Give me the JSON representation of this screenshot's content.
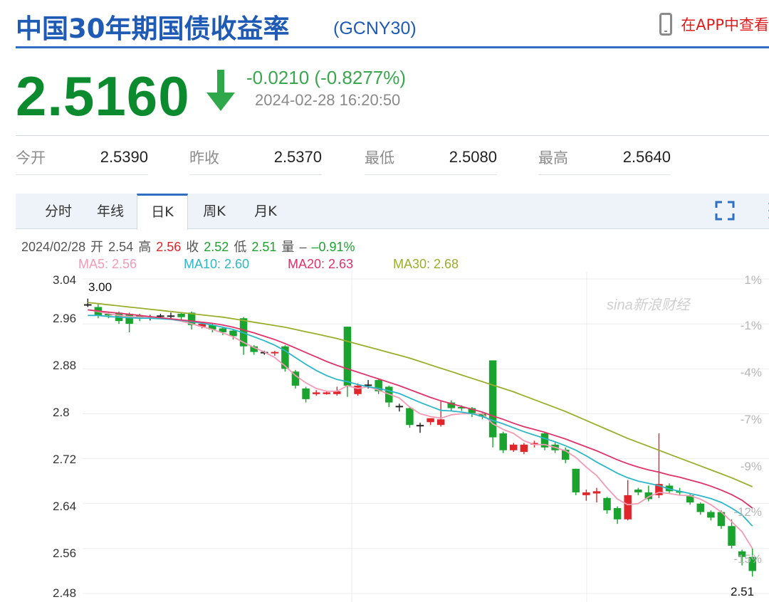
{
  "header": {
    "title": "中国30年期国债收益率",
    "code": "(GCNY30)",
    "app_link": "在APP中查看"
  },
  "quote": {
    "price": "2.5160",
    "change": "-0.0210 (-0.8277%)",
    "timestamp": "2024-02-28 16:20:50",
    "direction": "down",
    "down_color": "#0b8a2e"
  },
  "stats": [
    {
      "label": "今开",
      "value": "2.5390"
    },
    {
      "label": "昨收",
      "value": "2.5370"
    },
    {
      "label": "最低",
      "value": "2.5080"
    },
    {
      "label": "最高",
      "value": "2.5640"
    }
  ],
  "tabs": [
    {
      "label": "分时",
      "active": false
    },
    {
      "label": "年线",
      "active": false
    },
    {
      "label": "日K",
      "active": true
    },
    {
      "label": "周K",
      "active": false
    },
    {
      "label": "月K",
      "active": false
    }
  ],
  "icons": {
    "fullscreen": "fullscreen-icon",
    "more": "more-vertical-icon",
    "phone": "phone-icon",
    "arrow": "arrow-down-icon"
  },
  "info": {
    "date": "2024/02/28",
    "open_label": "开",
    "open": "2.54",
    "high_label": "高",
    "high": "2.56",
    "close_label": "收",
    "close": "2.52",
    "low_label": "低",
    "low": "2.51",
    "vol_label": "量",
    "vol": "–",
    "pct": "–0.91%"
  },
  "ma_legend": [
    {
      "text": "MA5: 2.56",
      "color": "#f29bb5"
    },
    {
      "text": "MA10: 2.60",
      "color": "#2cb7c9"
    },
    {
      "text": "MA20: 2.63",
      "color": "#e0336a"
    },
    {
      "text": "MA30: 2.68",
      "color": "#9aae2c"
    }
  ],
  "watermark": "sina新浪财经",
  "chart_data": {
    "type": "candlestick",
    "ylim": [
      2.48,
      3.04
    ],
    "y_ticks": [
      "3.04",
      "2.96",
      "2.88",
      "2.8",
      "2.72",
      "2.64",
      "2.56",
      "2.48"
    ],
    "pct_ticks": [
      "1%",
      "-1%",
      "-4%",
      "-7%",
      "-9%",
      "-12%",
      "-15%"
    ],
    "max_label": "3.00",
    "min_label": "2.51",
    "up_color": "#e0262b",
    "down_color": "#1aa32e",
    "candles": [
      [
        2.995,
        2.995,
        3.005,
        2.99
      ],
      [
        2.99,
        2.975,
        2.995,
        2.97
      ],
      [
        2.978,
        2.975,
        2.98,
        2.97
      ],
      [
        2.98,
        2.965,
        2.982,
        2.96
      ],
      [
        2.978,
        2.96,
        2.98,
        2.945
      ],
      [
        2.975,
        2.97,
        2.978,
        2.965
      ],
      [
        2.972,
        2.972,
        2.976,
        2.966
      ],
      [
        2.975,
        2.975,
        2.978,
        2.97
      ],
      [
        2.975,
        2.975,
        2.98,
        2.97
      ],
      [
        2.978,
        2.972,
        2.98,
        2.968
      ],
      [
        2.98,
        2.958,
        2.982,
        2.95
      ],
      [
        2.955,
        2.96,
        2.962,
        2.952
      ],
      [
        2.958,
        2.95,
        2.962,
        2.945
      ],
      [
        2.952,
        2.945,
        2.955,
        2.94
      ],
      [
        2.948,
        2.938,
        2.95,
        2.932
      ],
      [
        2.97,
        2.92,
        2.972,
        2.905
      ],
      [
        2.92,
        2.91,
        2.922,
        2.905
      ],
      [
        2.91,
        2.91,
        2.912,
        2.905
      ],
      [
        2.908,
        2.91,
        2.912,
        2.903
      ],
      [
        2.92,
        2.88,
        2.922,
        2.875
      ],
      [
        2.875,
        2.85,
        2.878,
        2.845
      ],
      [
        2.845,
        2.826,
        2.848,
        2.82
      ],
      [
        2.835,
        2.838,
        2.842,
        2.832
      ],
      [
        2.835,
        2.838,
        2.84,
        2.834
      ],
      [
        2.835,
        2.84,
        2.848,
        2.832
      ],
      [
        2.955,
        2.85,
        2.955,
        2.83
      ],
      [
        2.835,
        2.85,
        2.854,
        2.832
      ],
      [
        2.852,
        2.852,
        2.86,
        2.845
      ],
      [
        2.86,
        2.84,
        2.862,
        2.835
      ],
      [
        2.848,
        2.82,
        2.85,
        2.812
      ],
      [
        2.814,
        2.814,
        2.818,
        2.804
      ],
      [
        2.81,
        2.78,
        2.812,
        2.775
      ],
      [
        2.78,
        2.78,
        2.784,
        2.766
      ],
      [
        2.785,
        2.792,
        2.792,
        2.78
      ],
      [
        2.78,
        2.79,
        2.822,
        2.777
      ],
      [
        2.82,
        2.81,
        2.824,
        2.805
      ],
      [
        2.812,
        2.81,
        2.815,
        2.805
      ],
      [
        2.81,
        2.8,
        2.812,
        2.794
      ],
      [
        2.8,
        2.795,
        2.802,
        2.79
      ],
      [
        2.895,
        2.758,
        2.895,
        2.74
      ],
      [
        2.765,
        2.735,
        2.768,
        2.73
      ],
      [
        2.735,
        2.745,
        2.748,
        2.732
      ],
      [
        2.732,
        2.745,
        2.748,
        2.728
      ],
      [
        2.745,
        2.748,
        2.752,
        2.74
      ],
      [
        2.765,
        2.74,
        2.768,
        2.735
      ],
      [
        2.745,
        2.735,
        2.75,
        2.73
      ],
      [
        2.736,
        2.718,
        2.74,
        2.712
      ],
      [
        2.702,
        2.66,
        2.702,
        2.655
      ],
      [
        2.655,
        2.66,
        2.665,
        2.645
      ],
      [
        2.658,
        2.662,
        2.668,
        2.642
      ],
      [
        2.65,
        2.628,
        2.652,
        2.622
      ],
      [
        2.632,
        2.612,
        2.635,
        2.604
      ],
      [
        2.612,
        2.655,
        2.682,
        2.61
      ],
      [
        2.665,
        2.66,
        2.668,
        2.655
      ],
      [
        2.66,
        2.648,
        2.672,
        2.644
      ],
      [
        2.655,
        2.675,
        2.765,
        2.65
      ],
      [
        2.672,
        2.662,
        2.676,
        2.658
      ],
      [
        2.662,
        2.66,
        2.668,
        2.654
      ],
      [
        2.655,
        2.642,
        2.658,
        2.638
      ],
      [
        2.64,
        2.625,
        2.642,
        2.62
      ],
      [
        2.625,
        2.615,
        2.628,
        2.61
      ],
      [
        2.625,
        2.6,
        2.628,
        2.595
      ],
      [
        2.6,
        2.565,
        2.612,
        2.56
      ],
      [
        2.555,
        2.545,
        2.558,
        2.53
      ],
      [
        2.545,
        2.52,
        2.56,
        2.51
      ]
    ],
    "ma": {
      "MA5": [
        2.985,
        2.982,
        2.978,
        2.975,
        2.973,
        2.972,
        2.971,
        2.97,
        2.968,
        2.965,
        2.96,
        2.955,
        2.95,
        2.944,
        2.937,
        2.927,
        2.918,
        2.91,
        2.9,
        2.885,
        2.868,
        2.855,
        2.845,
        2.84,
        2.84,
        2.85,
        2.845,
        2.848,
        2.842,
        2.835,
        2.828,
        2.812,
        2.8,
        2.795,
        2.792,
        2.798,
        2.8,
        2.8,
        2.8,
        2.782,
        2.772,
        2.765,
        2.752,
        2.745,
        2.745,
        2.74,
        2.734,
        2.722,
        2.705,
        2.69,
        2.668,
        2.648,
        2.638,
        2.64,
        2.652,
        2.66,
        2.658,
        2.655,
        2.654,
        2.648,
        2.638,
        2.625,
        2.608,
        2.59,
        2.56
      ],
      "MA10": [
        2.975,
        2.975,
        2.973,
        2.972,
        2.971,
        2.97,
        2.97,
        2.969,
        2.968,
        2.966,
        2.964,
        2.961,
        2.958,
        2.954,
        2.95,
        2.944,
        2.937,
        2.93,
        2.922,
        2.912,
        2.9,
        2.888,
        2.877,
        2.868,
        2.861,
        2.857,
        2.852,
        2.848,
        2.845,
        2.841,
        2.836,
        2.828,
        2.82,
        2.813,
        2.806,
        2.805,
        2.803,
        2.8,
        2.795,
        2.788,
        2.782,
        2.775,
        2.768,
        2.762,
        2.756,
        2.75,
        2.743,
        2.735,
        2.725,
        2.714,
        2.704,
        2.694,
        2.686,
        2.68,
        2.676,
        2.672,
        2.666,
        2.662,
        2.658,
        2.654,
        2.649,
        2.642,
        2.632,
        2.62,
        2.6
      ],
      "MA20": [
        2.985,
        2.983,
        2.981,
        2.979,
        2.977,
        2.975,
        2.973,
        2.971,
        2.969,
        2.967,
        2.965,
        2.963,
        2.961,
        2.958,
        2.954,
        2.949,
        2.944,
        2.938,
        2.932,
        2.925,
        2.917,
        2.909,
        2.901,
        2.893,
        2.886,
        2.88,
        2.874,
        2.868,
        2.862,
        2.856,
        2.85,
        2.843,
        2.836,
        2.829,
        2.823,
        2.818,
        2.813,
        2.808,
        2.803,
        2.796,
        2.79,
        2.783,
        2.777,
        2.772,
        2.767,
        2.761,
        2.755,
        2.748,
        2.741,
        2.734,
        2.726,
        2.718,
        2.711,
        2.705,
        2.7,
        2.696,
        2.691,
        2.687,
        2.682,
        2.677,
        2.671,
        2.664,
        2.656,
        2.646,
        2.632
      ],
      "MA30": [
        2.998,
        2.996,
        2.994,
        2.992,
        2.99,
        2.988,
        2.986,
        2.984,
        2.982,
        2.98,
        2.978,
        2.976,
        2.974,
        2.972,
        2.969,
        2.966,
        2.963,
        2.96,
        2.957,
        2.954,
        2.95,
        2.946,
        2.942,
        2.938,
        2.934,
        2.929,
        2.924,
        2.919,
        2.914,
        2.909,
        2.904,
        2.899,
        2.893,
        2.887,
        2.881,
        2.875,
        2.869,
        2.863,
        2.857,
        2.851,
        2.845,
        2.839,
        2.832,
        2.825,
        2.818,
        2.811,
        2.804,
        2.796,
        2.788,
        2.78,
        2.772,
        2.764,
        2.756,
        2.749,
        2.742,
        2.735,
        2.728,
        2.721,
        2.714,
        2.707,
        2.7,
        2.693,
        2.686,
        2.678,
        2.67
      ]
    }
  }
}
